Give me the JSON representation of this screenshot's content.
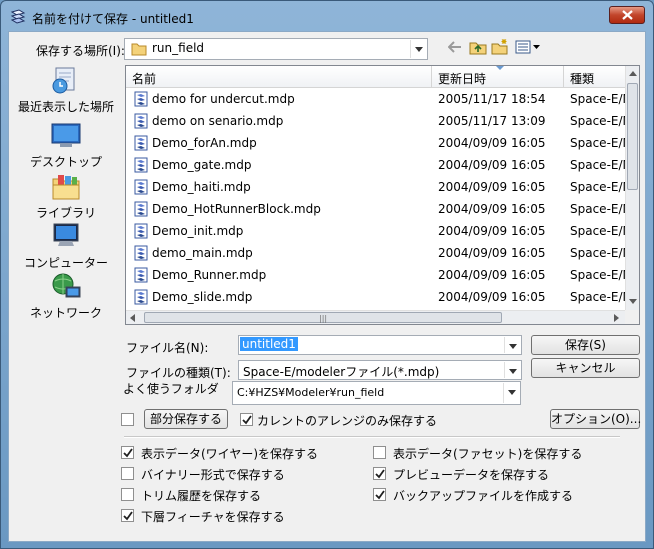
{
  "window": {
    "title": "名前を付けて保存 - untitled1"
  },
  "location": {
    "label": "保存する場所(I):",
    "value": "run_field"
  },
  "places": [
    {
      "label": "最近表示した場所",
      "icon": "recent-places-icon"
    },
    {
      "label": "デスクトップ",
      "icon": "desktop-icon"
    },
    {
      "label": "ライブラリ",
      "icon": "libraries-icon"
    },
    {
      "label": "コンピューター",
      "icon": "computer-icon"
    },
    {
      "label": "ネットワーク",
      "icon": "network-icon"
    }
  ],
  "columns": {
    "name": "名前",
    "date": "更新日時",
    "type": "種類"
  },
  "files": [
    {
      "name": "demo for undercut.mdp",
      "date": "2005/11/17 18:54",
      "type": "Space-E/Mo"
    },
    {
      "name": "demo on senario.mdp",
      "date": "2005/11/17 13:09",
      "type": "Space-E/Mo"
    },
    {
      "name": "Demo_forAn.mdp",
      "date": "2004/09/09 16:05",
      "type": "Space-E/Mo"
    },
    {
      "name": "Demo_gate.mdp",
      "date": "2004/09/09 16:05",
      "type": "Space-E/Mo"
    },
    {
      "name": "Demo_haiti.mdp",
      "date": "2004/09/09 16:05",
      "type": "Space-E/Mo"
    },
    {
      "name": "Demo_HotRunnerBlock.mdp",
      "date": "2004/09/09 16:05",
      "type": "Space-E/Mo"
    },
    {
      "name": "Demo_init.mdp",
      "date": "2004/09/09 16:05",
      "type": "Space-E/Mo"
    },
    {
      "name": "demo_main.mdp",
      "date": "2004/09/09 16:05",
      "type": "Space-E/Mo"
    },
    {
      "name": "Demo_Runner.mdp",
      "date": "2004/09/09 16:05",
      "type": "Space-E/Mo"
    },
    {
      "name": "Demo_slide.mdp",
      "date": "2004/09/09 16:05",
      "type": "Space-E/Mo"
    }
  ],
  "filename": {
    "label": "ファイル名(N):",
    "value": "untitled1"
  },
  "filetype": {
    "label": "ファイルの種類(T):",
    "value": "Space-E/modelerファイル(*.mdp)"
  },
  "favorite": {
    "label": "よく使うフォルダ",
    "value": "C:¥HZS¥Modeler¥run_field"
  },
  "buttons": {
    "save": "保存(S)",
    "cancel": "キャンセル",
    "partial_save": "部分保存する",
    "options": "オプション(O)..."
  },
  "options": {
    "current_arrange_only": {
      "label": "カレントのアレンジのみ保存する",
      "checked": true
    },
    "partial_checkbox": {
      "checked": false
    },
    "display_wire": {
      "label": "表示データ(ワイヤー)を保存する",
      "checked": true
    },
    "binary": {
      "label": "バイナリー形式で保存する",
      "checked": false
    },
    "trim_history": {
      "label": "トリム履歴を保存する",
      "checked": false
    },
    "lower_feature": {
      "label": "下層フィーチャを保存する",
      "checked": true
    },
    "display_facet": {
      "label": "表示データ(ファセット)を保存する",
      "checked": false
    },
    "preview": {
      "label": "プレビューデータを保存する",
      "checked": true
    },
    "backup": {
      "label": "バックアップファイルを作成する",
      "checked": true
    }
  },
  "colors": {
    "accent": "#3399ff",
    "selection": "#3399ff"
  }
}
